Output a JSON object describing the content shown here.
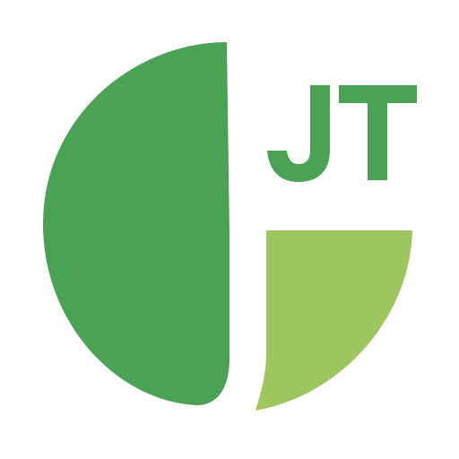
{
  "logo": {
    "monogram": "JT",
    "icon": "jt-leaf-logo-icon",
    "colors": {
      "dark_green": "#4aa255",
      "light_green": "#9dc75e",
      "background": "#ffffff"
    }
  }
}
